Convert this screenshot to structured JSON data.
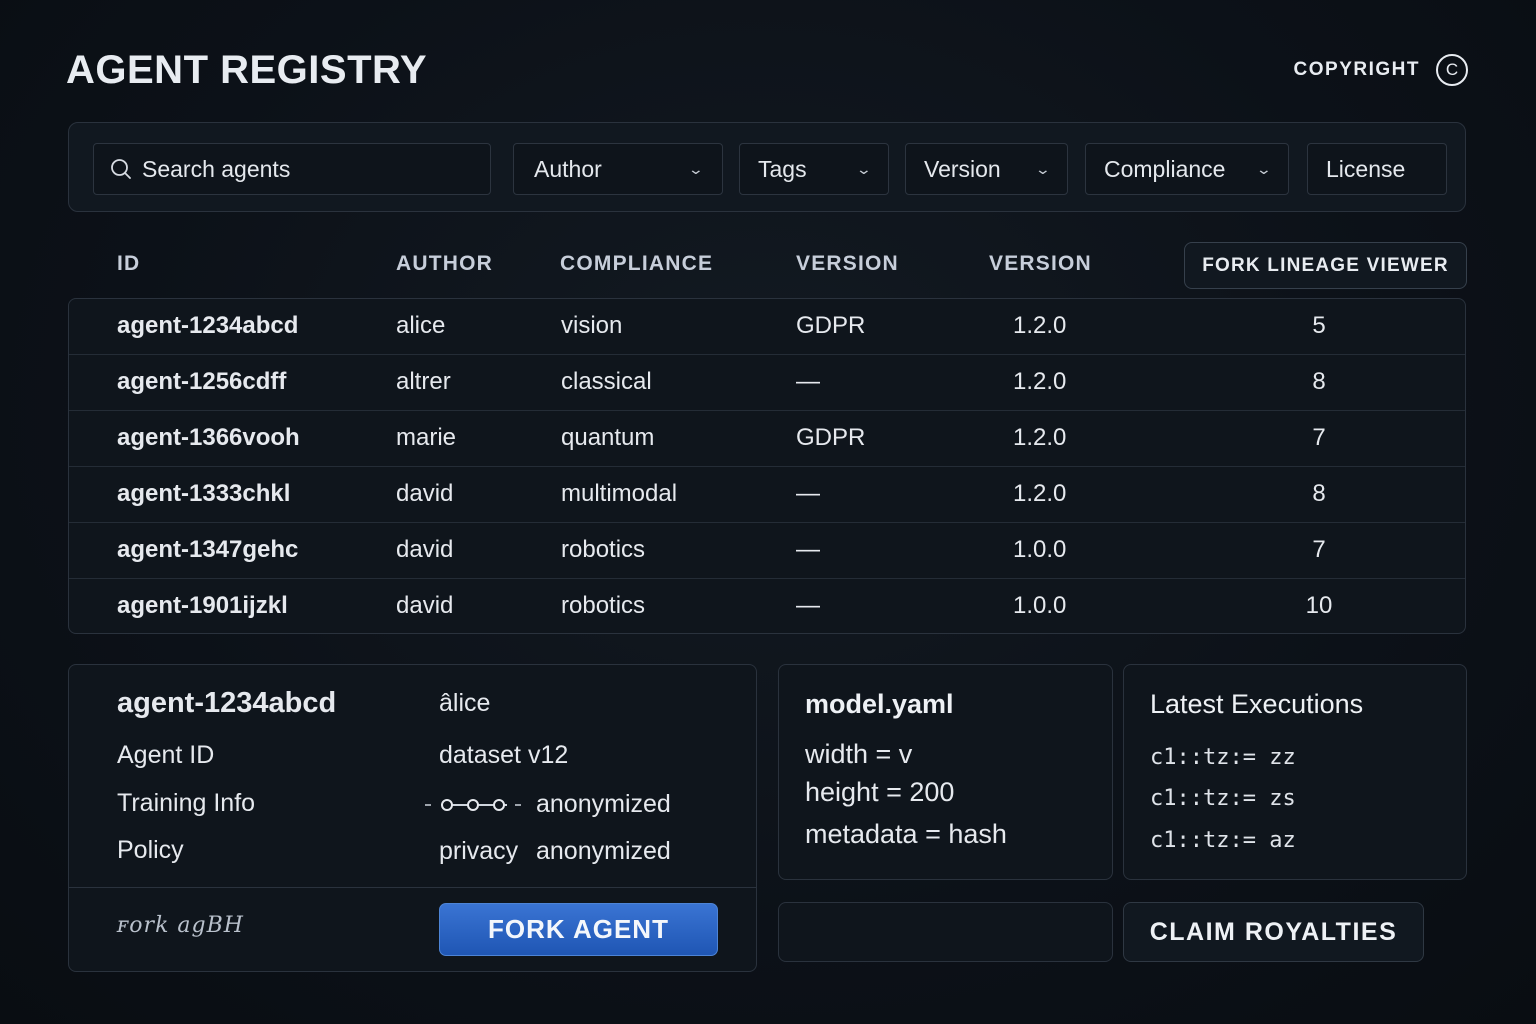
{
  "header": {
    "title": "AGENT REGISTRY",
    "copyright_label": "COPYRIGHT",
    "copyright_symbol": "C"
  },
  "filters": {
    "search_placeholder": "Search agents",
    "author": "Author",
    "tags": "Tags",
    "version": "Version",
    "compliance": "Compliance",
    "license": "License"
  },
  "table": {
    "columns": [
      "ID",
      "AUTHOR",
      "COMPLIANCE",
      "VERSION",
      "VERSION"
    ],
    "fork_viewer_label": "FORK LINEAGE VIEWER",
    "rows": [
      {
        "id": "agent-1234abcd",
        "author": "alice",
        "tag": "vision",
        "compliance": "GDPR",
        "version": "1.2.0",
        "forks": "5"
      },
      {
        "id": "agent-1256cdff",
        "author": "altrer",
        "tag": "classical",
        "compliance": "—",
        "version": "1.2.0",
        "forks": "8"
      },
      {
        "id": "agent-1366vooh",
        "author": "marie",
        "tag": "quantum",
        "compliance": "GDPR",
        "version": "1.2.0",
        "forks": "7"
      },
      {
        "id": "agent-1333chkl",
        "author": "david",
        "tag": "multimodal",
        "compliance": "—",
        "version": "1.2.0",
        "forks": "8"
      },
      {
        "id": "agent-1347gehc",
        "author": "david",
        "tag": "robotics",
        "compliance": "—",
        "version": "1.0.0",
        "forks": "7"
      },
      {
        "id": "agent-1901ijzkl",
        "author": "david",
        "tag": "robotics",
        "compliance": "—",
        "version": "1.0.0",
        "forks": "10"
      }
    ]
  },
  "detail": {
    "agent_id": "agent-1234abcd",
    "author": "âlice",
    "agent_id_label": "Agent ID",
    "dataset": "dataset v12",
    "training_label": "Training Info",
    "training_value": "anonymized",
    "policy_label": "Policy",
    "policy_key": "privacy",
    "policy_value": "anonymized",
    "logo_text": "ꜰork agBH",
    "fork_button": "FORK AGENT"
  },
  "yaml": {
    "title": "model.yaml",
    "lines": [
      "width = v",
      "height = 200",
      "metadata = hash"
    ]
  },
  "executions": {
    "title": "Latest Executions",
    "lines": [
      "c1::tz:= zz",
      "c1::tz:= zs",
      "c1::tz:= az"
    ]
  },
  "actions": {
    "claim_royalties": "CLAIM ROYALTIES"
  }
}
